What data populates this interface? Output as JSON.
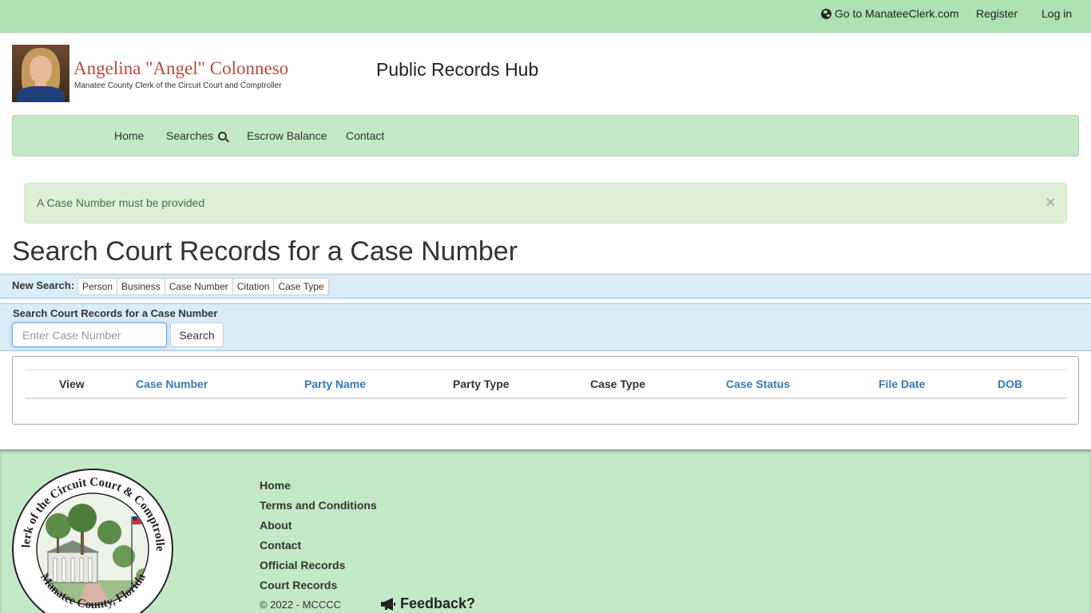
{
  "topbar": {
    "goto_label": "Go to ManateeClerk.com",
    "register_label": "Register",
    "login_label": "Log in"
  },
  "header": {
    "clerk_name": "Angelina \"Angel\" Colonneso",
    "clerk_subtitle": "Manatee County Clerk of the Circuit Court and Comptroller",
    "hub_title": "Public Records Hub"
  },
  "nav": {
    "items": [
      {
        "label": "Home"
      },
      {
        "label": "Searches"
      },
      {
        "label": "Escrow Balance"
      },
      {
        "label": "Contact"
      }
    ]
  },
  "alert": {
    "message": "A Case Number must be provided",
    "close_glyph": "×"
  },
  "page": {
    "title": "Search Court Records for a Case Number"
  },
  "new_search": {
    "label": "New Search:",
    "options": [
      "Person",
      "Business",
      "Case Number",
      "Citation",
      "Case Type"
    ]
  },
  "search_panel": {
    "label": "Search Court Records for a Case Number",
    "input_value": "",
    "input_placeholder": "Enter Case Number",
    "button_label": "Search"
  },
  "results": {
    "columns": [
      "View",
      "Case Number",
      "Party Name",
      "Party Type",
      "Case Type",
      "Case Status",
      "File Date",
      "DOB"
    ]
  },
  "footer": {
    "links": [
      "Home",
      "Terms and Conditions",
      "About",
      "Contact",
      "Official Records",
      "Court Records"
    ],
    "copyright": "© 2022 - MCCCC",
    "feedback_label": "Feedback?",
    "seal_top_text": "Clerk of the Circuit Court & Comptroller",
    "seal_bottom_text": "Manatee County, Florida"
  },
  "colors": {
    "topbar_bg": "#ade2b2",
    "nav_bg": "#c4e9c7",
    "alert_bg": "#dff0d8",
    "alert_text": "#3c763d",
    "search_bg": "#d9edf7",
    "link": "#337ab7",
    "clerk_name": "#b94a3e"
  },
  "icons": {
    "goto": "globe-icon",
    "searches": "search-icon",
    "feedback": "megaphone-icon",
    "close": "close-icon"
  }
}
